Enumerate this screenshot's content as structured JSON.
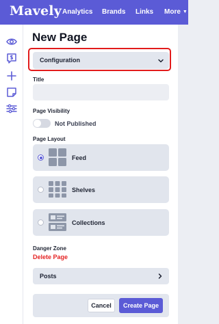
{
  "app": {
    "logo": "Mavely"
  },
  "nav": {
    "analytics": "Analytics",
    "brands": "Brands",
    "links": "Links",
    "more": "More",
    "more_icon": "chevron-down-icon"
  },
  "sidebar": {
    "icons": [
      "eye-icon",
      "dollar-chat-icon",
      "plus-icon",
      "note-icon",
      "sliders-icon"
    ]
  },
  "page": {
    "title": "New Page",
    "configuration_label": "Configuration",
    "title_label": "Title",
    "title_value": "",
    "title_placeholder": "",
    "visibility_label": "Page Visibility",
    "visibility_toggle_on": false,
    "visibility_status": "Not Published",
    "layout_label": "Page Layout",
    "layouts": [
      {
        "label": "Feed",
        "selected": true,
        "icon": "grid-icon"
      },
      {
        "label": "Shelves",
        "selected": false,
        "icon": "shelves-icon"
      },
      {
        "label": "Collections",
        "selected": false,
        "icon": "collections-icon"
      }
    ],
    "danger_zone_label": "Danger Zone",
    "delete_label": "Delete Page",
    "posts_label": "Posts"
  },
  "actions": {
    "cancel": "Cancel",
    "create": "Create Page"
  },
  "colors": {
    "brand": "#5b5bd6",
    "danger": "#e52424",
    "highlight": "#e21b1b",
    "card_bg": "#e1e5ed",
    "page_bg": "#eceef3"
  }
}
